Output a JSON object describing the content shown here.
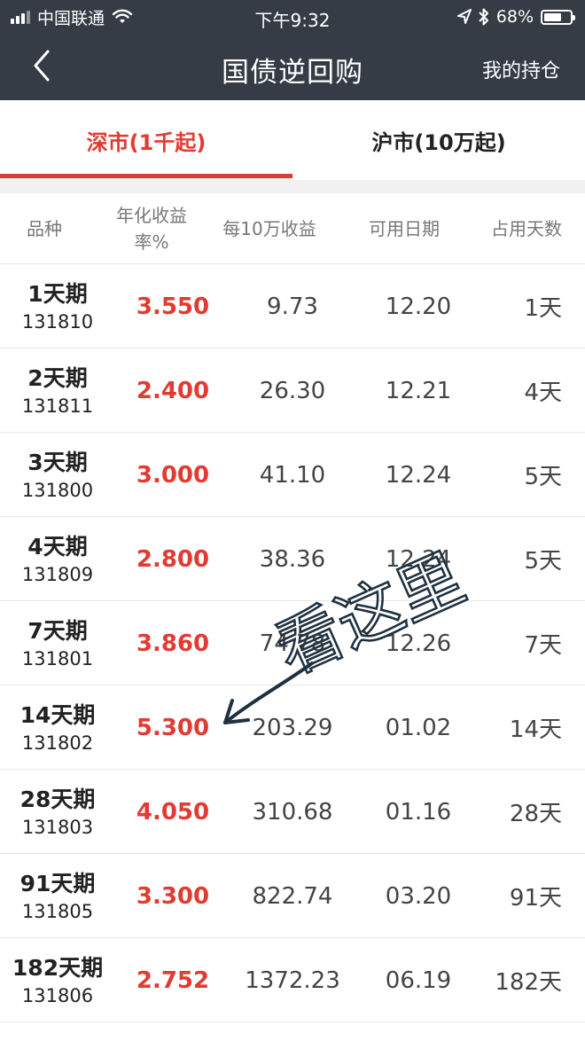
{
  "status_bar": {
    "carrier": "中国联通",
    "time": "下午9:32",
    "battery": "68%",
    "battery_level": 0.68
  },
  "nav": {
    "title": "国债逆回购",
    "right_action": "我的持仓"
  },
  "tabs": [
    {
      "label": "深市(1千起)",
      "active": true
    },
    {
      "label": "沪市(10万起)",
      "active": false
    }
  ],
  "table": {
    "headers": [
      "品种",
      "年化收益率%",
      "每10万收益",
      "可用日期",
      "占用天数"
    ],
    "rows": [
      {
        "name": "1天期",
        "code": "131810",
        "rate": "3.550",
        "income": "9.73",
        "date": "12.20",
        "days": "1天"
      },
      {
        "name": "2天期",
        "code": "131811",
        "rate": "2.400",
        "income": "26.30",
        "date": "12.21",
        "days": "4天"
      },
      {
        "name": "3天期",
        "code": "131800",
        "rate": "3.000",
        "income": "41.10",
        "date": "12.24",
        "days": "5天"
      },
      {
        "name": "4天期",
        "code": "131809",
        "rate": "2.800",
        "income": "38.36",
        "date": "12.24",
        "days": "5天"
      },
      {
        "name": "7天期",
        "code": "131801",
        "rate": "3.860",
        "income": "74.78",
        "date": "12.26",
        "days": "7天"
      },
      {
        "name": "14天期",
        "code": "131802",
        "rate": "5.300",
        "income": "203.29",
        "date": "01.02",
        "days": "14天"
      },
      {
        "name": "28天期",
        "code": "131803",
        "rate": "4.050",
        "income": "310.68",
        "date": "01.16",
        "days": "28天"
      },
      {
        "name": "91天期",
        "code": "131805",
        "rate": "3.300",
        "income": "822.74",
        "date": "03.20",
        "days": "91天"
      },
      {
        "name": "182天期",
        "code": "131806",
        "rate": "2.752",
        "income": "1372.23",
        "date": "06.19",
        "days": "182天"
      }
    ]
  },
  "annotation": {
    "text": "看这里",
    "arrow_icon": "hand-drawn-arrow-icon"
  },
  "colors": {
    "header_bg": "#353c46",
    "accent_red": "#e13b32",
    "ink": "#1f3140"
  }
}
